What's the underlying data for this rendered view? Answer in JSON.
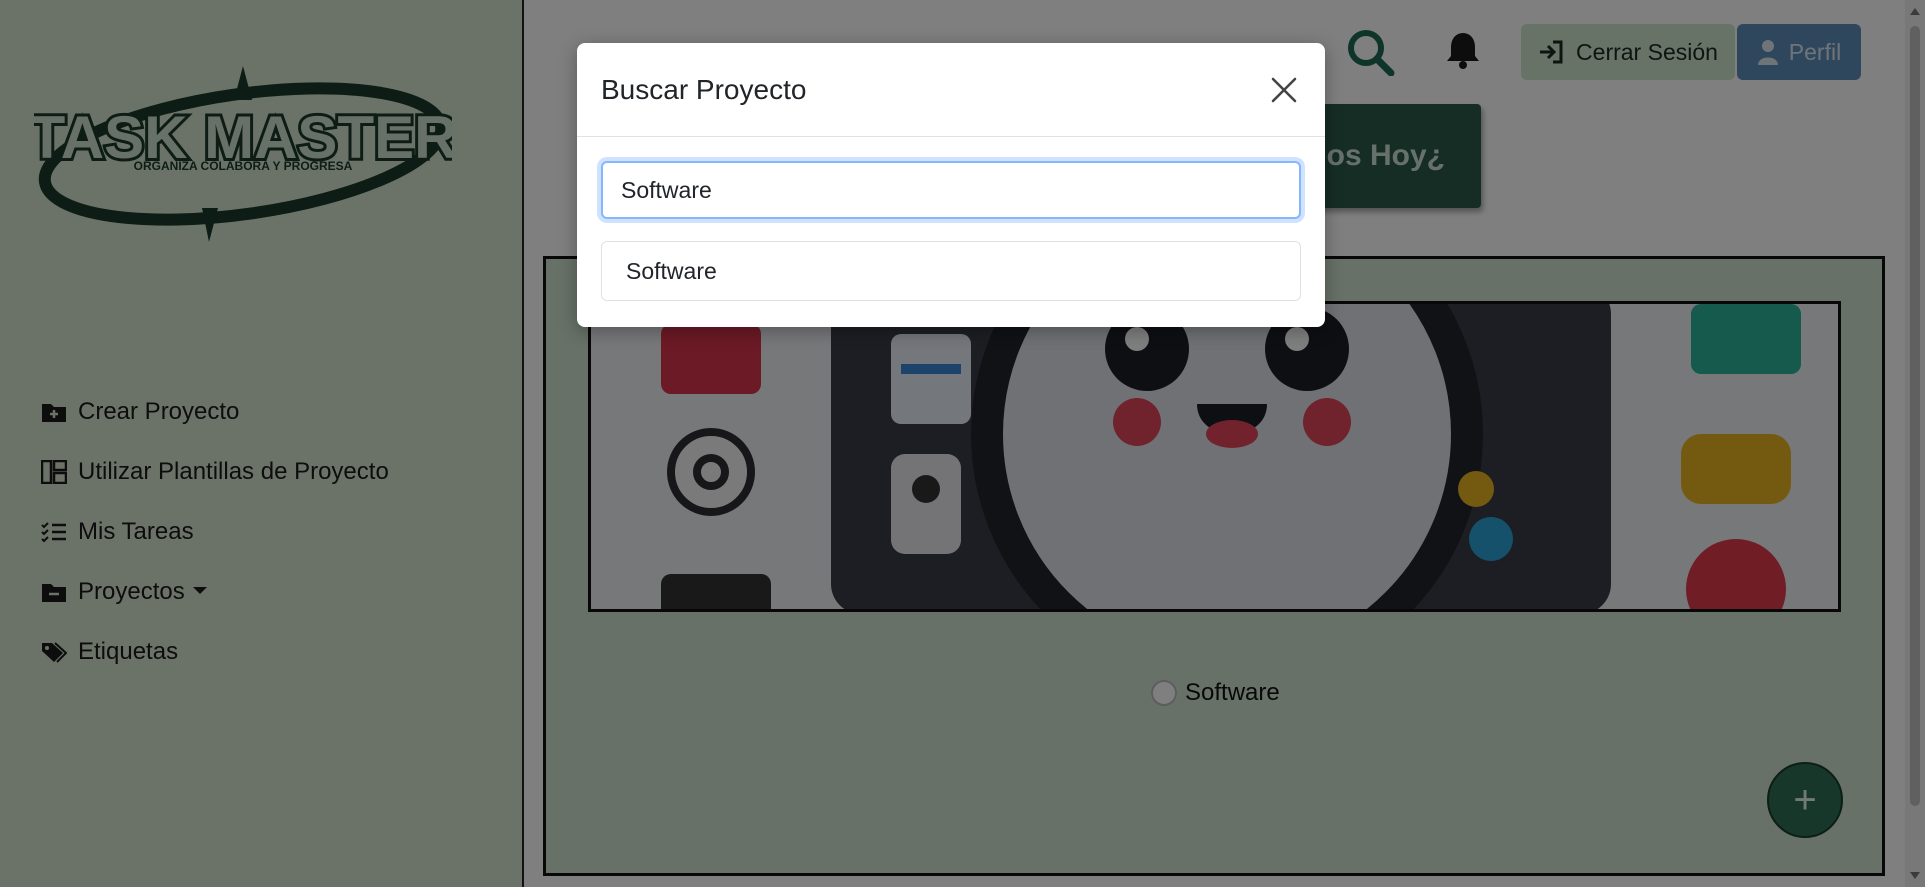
{
  "sidebar": {
    "logo": {
      "title": "TASK MASTER",
      "tagline": "ORGANIZA COLABORA Y PROGRESA"
    },
    "items": [
      {
        "label": "Crear Proyecto",
        "icon": "folder-plus-icon"
      },
      {
        "label": "Utilizar Plantillas de Proyecto",
        "icon": "template-icon"
      },
      {
        "label": "Mis Tareas",
        "icon": "tasks-list-icon"
      },
      {
        "label": "Proyectos",
        "icon": "folder-minus-icon"
      },
      {
        "label": "Etiquetas",
        "icon": "tags-icon"
      }
    ]
  },
  "header": {
    "logout_label": "Cerrar Sesión",
    "profile_label": "Perfil",
    "today_label": "¿Qué Hacemos Hoy?"
  },
  "main": {
    "project_name": "Software",
    "fab_label": "+"
  },
  "modal": {
    "title": "Buscar Proyecto",
    "search_value": "Software",
    "results": [
      "Software"
    ]
  },
  "colors": {
    "brand_green": "#2c5b4a",
    "panel_green": "#cfe3cf",
    "profile_blue": "#5c8fb8"
  }
}
